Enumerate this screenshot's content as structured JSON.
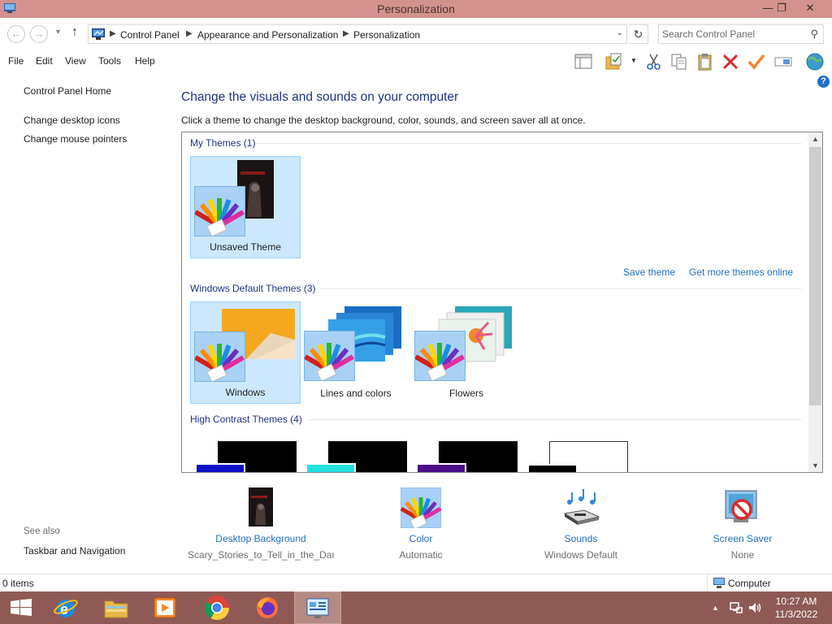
{
  "window": {
    "title": "Personalization",
    "minimize": "—",
    "restore": "❐",
    "close": "✕"
  },
  "address": {
    "crumbs": [
      "Control Panel",
      "Appearance and Personalization",
      "Personalization"
    ],
    "search_placeholder": "Search Control Panel"
  },
  "menu": [
    "File",
    "Edit",
    "View",
    "Tools",
    "Help"
  ],
  "toolbar_icons": [
    "layout-icon",
    "properties-icon",
    "cut-icon",
    "copy-icon",
    "paste-icon",
    "delete-icon",
    "check-icon",
    "rename-icon",
    "globe-icon"
  ],
  "left_nav": {
    "home": "Control Panel Home",
    "links": [
      "Change desktop icons",
      "Change mouse pointers"
    ],
    "see_also_label": "See also",
    "see_also": [
      "Taskbar and Navigation"
    ]
  },
  "main": {
    "heading": "Change the visuals and sounds on your computer",
    "subtext": "Click a theme to change the desktop background, color, sounds, and screen saver all at once.",
    "my_themes": {
      "label": "My Themes (1)",
      "items": [
        "Unsaved Theme"
      ]
    },
    "save_theme": "Save theme",
    "get_more": "Get more themes online",
    "default_themes": {
      "label": "Windows Default Themes (3)",
      "items": [
        "Windows",
        "Lines and colors",
        "Flowers"
      ]
    },
    "high_contrast": {
      "label": "High Contrast Themes (4)"
    }
  },
  "settings": [
    {
      "label": "Desktop Background",
      "value": "Scary_Stories_to_Tell_in_the_Dark_fi..."
    },
    {
      "label": "Color",
      "value": "Automatic"
    },
    {
      "label": "Sounds",
      "value": "Windows Default"
    },
    {
      "label": "Screen Saver",
      "value": "None"
    }
  ],
  "status": {
    "items": "0 items",
    "location": "Computer"
  },
  "taskbar": {
    "time": "10:27 AM",
    "date": "11/3/2022",
    "apps": [
      "windows-start-icon",
      "internet-explorer-icon",
      "file-explorer-icon",
      "media-player-icon",
      "chrome-icon",
      "firefox-icon",
      "control-panel-icon"
    ]
  },
  "colors": {
    "title_bar": "#d3928e",
    "taskbar": "#8f5a55",
    "link": "#1e6fbf",
    "heading": "#1e3287",
    "selection": "#cce8ff"
  }
}
